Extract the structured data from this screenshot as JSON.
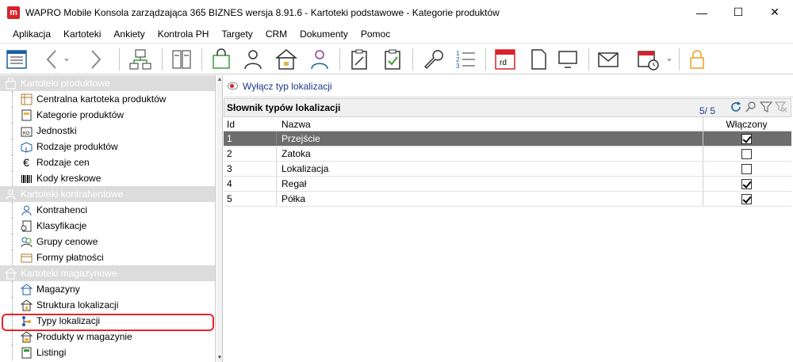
{
  "window": {
    "title": "WAPRO Mobile Konsola zarządzająca 365 BIZNES wersja 8.91.6 - Kartoteki podstawowe - Kategorie produktów",
    "app_icon_letter": "m"
  },
  "menu": [
    "Aplikacja",
    "Kartoteki",
    "Ankiety",
    "Kontrola PH",
    "Targety",
    "CRM",
    "Dokumenty",
    "Pomoc"
  ],
  "sidebar": {
    "groups": [
      {
        "label": "Kartoteki produktowe",
        "items": [
          "Centralna kartoteka produktów",
          "Kategorie produktów",
          "Jednostki",
          "Rodzaje produktów",
          "Rodzaje cen",
          "Kody kreskowe"
        ]
      },
      {
        "label": "Kartoteki kontrahentowe",
        "items": [
          "Kontrahenci",
          "Klasyfikacje",
          "Grupy cenowe",
          "Formy płatności"
        ]
      },
      {
        "label": "Kartoteki magazynowe",
        "items": [
          "Magazyny",
          "Struktura lokalizacji",
          "Typy lokalizacji",
          "Produkty w magazynie",
          "Listingi"
        ]
      }
    ]
  },
  "action": {
    "toggle_label": "Wyłącz typ lokalizacji"
  },
  "dictionary": {
    "title": "Słownik typów lokalizacji",
    "count": "5/ 5",
    "columns": {
      "id": "Id",
      "name": "Nazwa",
      "enabled": "Włączony"
    },
    "rows": [
      {
        "id": "1",
        "name": "Przejście",
        "enabled": true,
        "selected": true
      },
      {
        "id": "2",
        "name": "Zatoka",
        "enabled": false,
        "selected": false
      },
      {
        "id": "3",
        "name": "Lokalizacja",
        "enabled": false,
        "selected": false
      },
      {
        "id": "4",
        "name": "Regał",
        "enabled": true,
        "selected": false
      },
      {
        "id": "5",
        "name": "Półka",
        "enabled": true,
        "selected": false
      }
    ]
  },
  "toolbar": {
    "rd_label": "rd"
  },
  "colors": {
    "accent_red": "#d6232a",
    "selection": "#6d6d6d",
    "link_blue": "#1b3a8a"
  }
}
